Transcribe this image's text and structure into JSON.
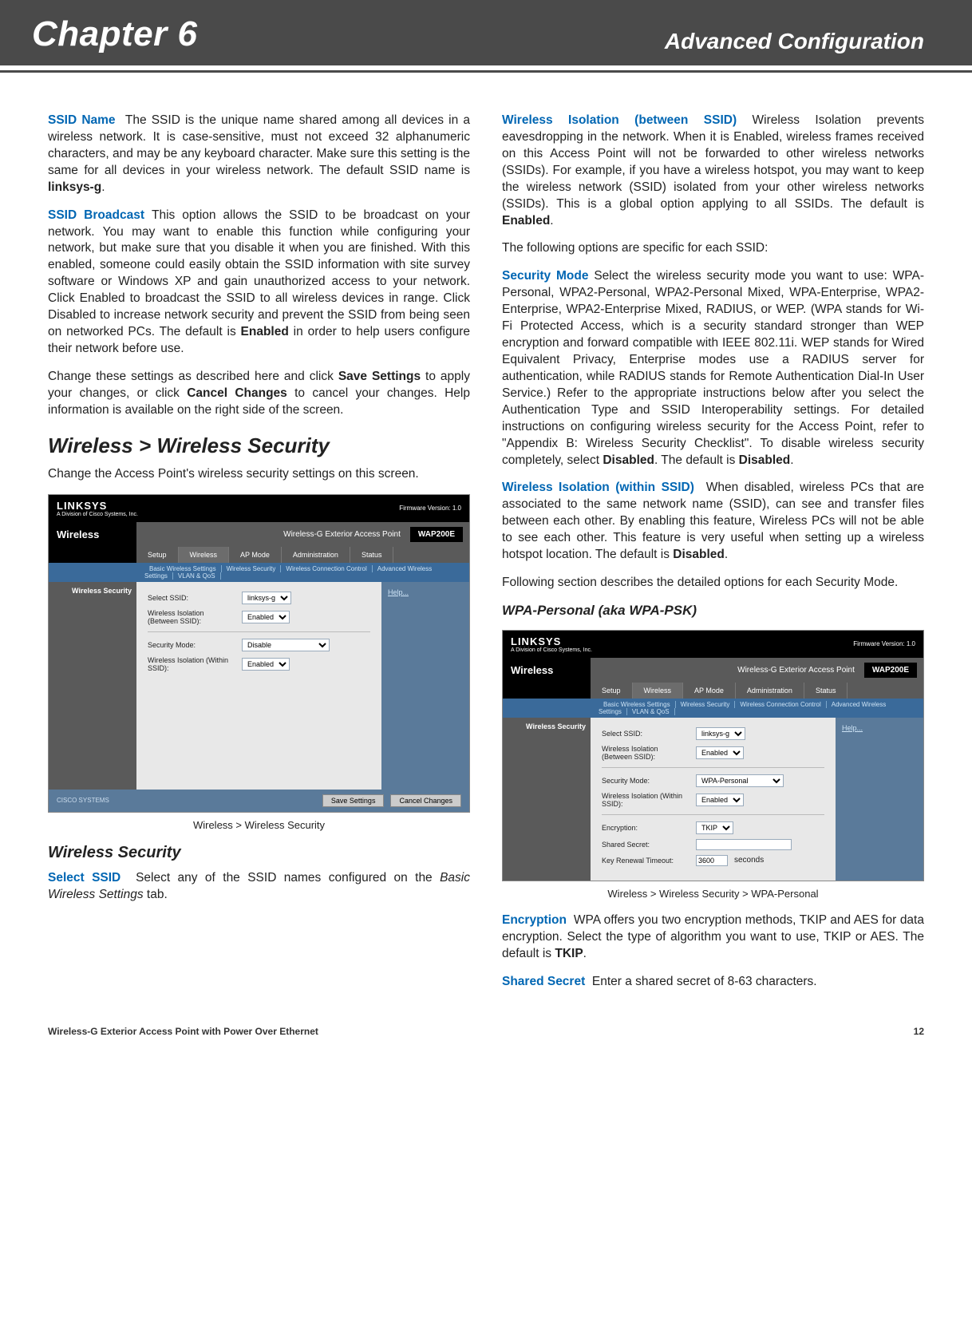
{
  "header": {
    "chapter": "Chapter 6",
    "title": "Advanced Configuration"
  },
  "left": {
    "ssid_name_term": "SSID Name",
    "ssid_name_text": "The SSID is the unique name shared among all devices in a wireless network. It is case-sensitive, must not exceed 32 alphanumeric characters, and may be any keyboard character. Make sure this setting is the same for all devices in your wireless network. The default SSID name is ",
    "ssid_name_bold": "linksys-g",
    "ssid_broadcast_term": "SSID Broadcast",
    "ssid_broadcast_text": "This option allows the SSID to be broadcast on your network. You may want to enable this function while configuring your network, but make sure that you disable it when you are finished. With this enabled, someone could easily obtain the SSID information with site survey software or Windows XP and gain unauthorized access to your network. Click Enabled to broadcast the SSID to all wireless devices in range. Click Disabled to increase network security and prevent the SSID from being seen on networked PCs. The default is ",
    "ssid_broadcast_bold": "Enabled",
    "ssid_broadcast_tail": " in order to help users configure their network before use.",
    "save_para_a": "Change these settings as described here and click ",
    "save_para_b": "Save Settings",
    "save_para_c": " to apply your changes, or click ",
    "save_para_d": "Cancel Changes",
    "save_para_e": " to cancel your changes. Help information is available on the right side of the screen.",
    "h2": "Wireless > Wireless Security",
    "h2_sub": "Change the Access Point's wireless security settings on this screen.",
    "fig1_caption": "Wireless > Wireless Security",
    "h3": "Wireless Security",
    "select_ssid_term": "Select SSID",
    "select_ssid_text_a": "Select any of the SSID names configured on the ",
    "select_ssid_text_i": "Basic Wireless Settings",
    "select_ssid_text_b": " tab."
  },
  "right": {
    "iso_between_term": "Wireless Isolation (between SSID)",
    "iso_between_text": "Wireless Isolation prevents eavesdropping in the network. When it is Enabled, wireless frames received on this Access Point will not be forwarded to other wireless networks (SSIDs). For example, if you have a wireless hotspot, you may want to keep the wireless network (SSID) isolated from your other wireless networks (SSIDs). This is a global option applying to all SSIDs. The default is ",
    "iso_between_bold": "Enabled",
    "following_options": "The following options are specific for each SSID:",
    "sec_mode_term": "Security Mode",
    "sec_mode_text_a": "Select the wireless security mode you want to use: WPA-Personal, WPA2-Personal, WPA2-Personal Mixed, WPA-Enterprise, WPA2-Enterprise, WPA2-Enterprise Mixed, RADIUS, or WEP. (WPA stands for Wi-Fi Protected Access, which is a security standard stronger than WEP encryption and forward compatible with IEEE 802.11i. WEP stands for Wired Equivalent Privacy, Enterprise modes use a RADIUS server for authentication, while RADIUS stands for Remote Authentication Dial-In User Service.) Refer to the appropriate instructions below after you select the Authentication Type and SSID Interoperability settings. For detailed instructions on configuring wireless security for the Access Point, refer to \"Appendix B: Wireless Security Checklist\". To disable wireless security completely, select ",
    "sec_mode_bold1": "Disabled",
    "sec_mode_text_b": ". The default is ",
    "sec_mode_bold2": "Disabled",
    "iso_within_term": "Wireless Isolation (within SSID)",
    "iso_within_text": "When disabled, wireless PCs that are associated to the same network name (SSID), can see and transfer files between each other. By enabling this feature, Wireless PCs will not be able to see each other. This feature is very useful when setting up a wireless hotspot location. The default is ",
    "iso_within_bold": "Disabled",
    "following_section": "Following section describes the detailed options for each Security Mode.",
    "h4": "WPA-Personal (aka WPA-PSK)",
    "fig2_caption": "Wireless > Wireless Security > WPA-Personal",
    "enc_term": "Encryption",
    "enc_text": "WPA offers you two encryption methods, TKIP and AES for data encryption. Select the type of algorithm you want to use, TKIP or AES. The default is ",
    "enc_bold": "TKIP",
    "ss_term": "Shared Secret",
    "ss_text": "Enter a shared secret of 8-63 characters."
  },
  "linksys": {
    "logo": "LINKSYS",
    "logo_sub": "A Division of Cisco Systems, Inc.",
    "fw": "Firmware Version: 1.0",
    "product": "Wireless-G Exterior Access Point",
    "model": "WAP200E",
    "section": "Wireless",
    "tabs": [
      "Setup",
      "Wireless",
      "AP Mode",
      "Administration",
      "Status"
    ],
    "subtabs": [
      "Basic Wireless Settings",
      "Wireless Security",
      "Wireless Connection Control",
      "Advanced Wireless Settings",
      "VLAN & QoS"
    ],
    "side_label": "Wireless Security",
    "help": "Help...",
    "select_ssid": "Select SSID:",
    "select_ssid_val": "linksys-g",
    "iso_between": "Wireless Isolation (Between SSID):",
    "iso_between_val": "Enabled",
    "sec_mode": "Security Mode:",
    "sec_mode_val_disable": "Disable",
    "sec_mode_val_wpa": "WPA-Personal",
    "iso_within": "Wireless Isolation (Within SSID):",
    "iso_within_val": "Enabled",
    "encryption": "Encryption:",
    "encryption_val": "TKIP",
    "shared_secret": "Shared Secret:",
    "key_renewal": "Key Renewal Timeout:",
    "key_renewal_val": "3600",
    "seconds": "seconds",
    "save": "Save Settings",
    "cancel": "Cancel Changes",
    "cisco": "CISCO SYSTEMS"
  },
  "footer": {
    "left": "Wireless-G Exterior Access Point with Power Over Ethernet",
    "right": "12"
  }
}
